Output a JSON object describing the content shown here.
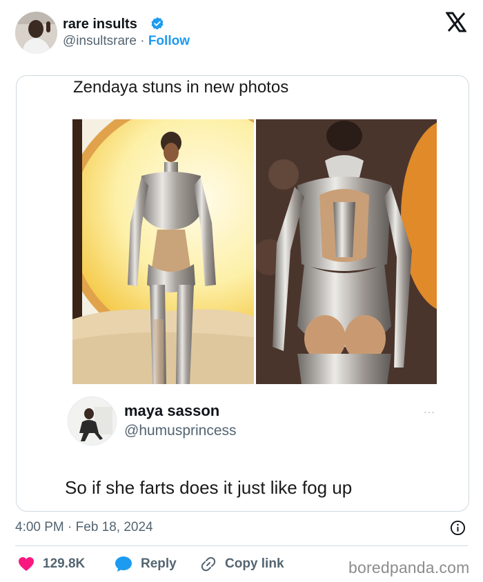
{
  "tweet": {
    "author_name": "rare insults",
    "author_handle": "@insultsrare",
    "separator": "·",
    "follow_label": "Follow",
    "timestamp": "4:00 PM · Feb 18, 2024",
    "likes": "129.8K",
    "reply_label": "Reply",
    "copy_link_label": "Copy link"
  },
  "embedded": {
    "headline": "Zendaya stuns in new photos",
    "quote": {
      "name": "maya sasson",
      "handle": "@humusprincess",
      "more": "···",
      "text": "So if she farts does it just like fog up"
    }
  },
  "watermark": "boredpanda.com",
  "colors": {
    "link_blue": "#1d9bf0",
    "like_red": "#f91880",
    "muted_gray": "#536471",
    "border": "#cfd9de"
  },
  "icons": [
    "verified-badge-icon",
    "x-logo-icon",
    "info-icon",
    "heart-icon",
    "reply-bubble-icon",
    "link-icon"
  ]
}
